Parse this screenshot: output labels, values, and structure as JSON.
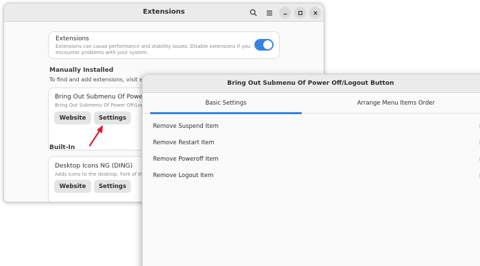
{
  "colors": {
    "accent": "#3584e4",
    "arrow": "#e01b24"
  },
  "ext_window": {
    "title": "Extensions",
    "header_icons": [
      "search-icon",
      "menu-icon",
      "minimize-icon",
      "maximize-icon",
      "close-icon"
    ],
    "extensions_toggle": {
      "title": "Extensions",
      "description_line1": "Extensions can cause performance and stability issues. Disable extensions if you",
      "description_line2": "encounter problems with your system.",
      "enabled": true
    },
    "manually_installed": {
      "heading": "Manually Installed",
      "subtext": "To find and add extensions, visit ",
      "link_text": "ex",
      "item": {
        "name": "Bring Out Submenu Of Power Off",
        "description": "Bring Out Submenu Of Power Off/Log",
        "website_label": "Website",
        "settings_label": "Settings"
      }
    },
    "built_in": {
      "heading": "Built-In",
      "item": {
        "name": "Desktop Icons NG (DING)",
        "description": "Adds icons to the desktop. Fork of the o",
        "website_label": "Website",
        "settings_label": "Settings"
      }
    }
  },
  "dialog": {
    "title": "Bring Out Submenu Of Power Off/Logout Button",
    "tabs": [
      {
        "label": "Basic Settings",
        "active": true
      },
      {
        "label": "Arrange Menu Items Order",
        "active": false
      }
    ],
    "options": [
      {
        "label": "Remove Suspend Item",
        "enabled": false
      },
      {
        "label": "Remove Restart Item",
        "enabled": false
      },
      {
        "label": "Remove Poweroff Item",
        "enabled": false
      },
      {
        "label": "Remove Logout Item",
        "enabled": false
      }
    ]
  }
}
